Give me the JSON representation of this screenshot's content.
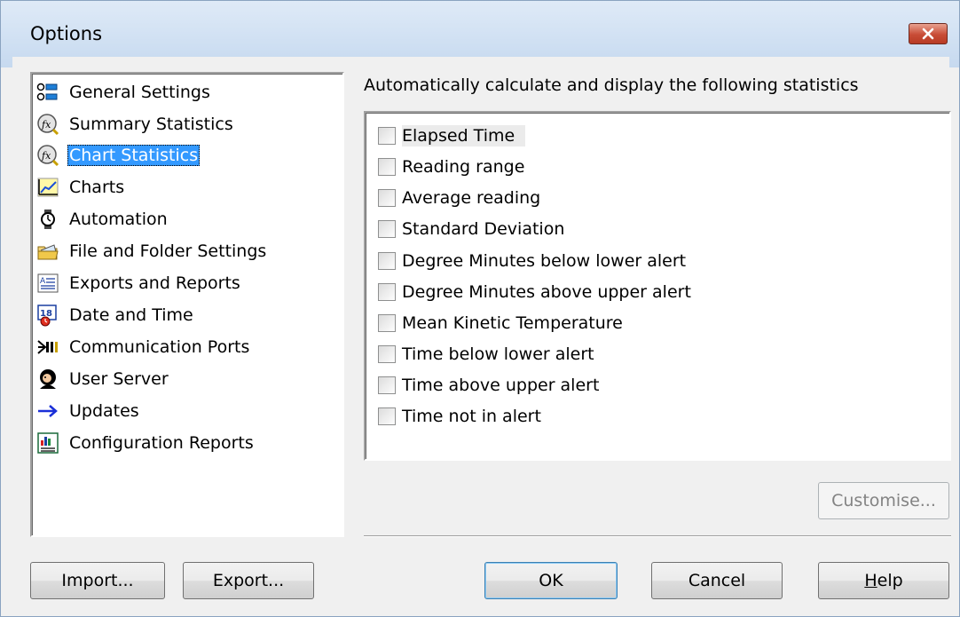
{
  "window": {
    "title": "Options",
    "close_icon": "close-icon"
  },
  "nav": {
    "items": [
      {
        "label": "General Settings",
        "icon": "general-settings-icon"
      },
      {
        "label": "Summary Statistics",
        "icon": "summary-statistics-icon"
      },
      {
        "label": "Chart Statistics",
        "icon": "chart-statistics-icon",
        "selected": true
      },
      {
        "label": "Charts",
        "icon": "charts-icon"
      },
      {
        "label": "Automation",
        "icon": "automation-icon"
      },
      {
        "label": "File and Folder Settings",
        "icon": "folder-icon"
      },
      {
        "label": "Exports and Reports",
        "icon": "exports-reports-icon"
      },
      {
        "label": "Date and Time",
        "icon": "date-time-icon"
      },
      {
        "label": "Communication Ports",
        "icon": "communication-ports-icon"
      },
      {
        "label": "User Server",
        "icon": "user-server-icon"
      },
      {
        "label": "Updates",
        "icon": "updates-arrow-icon"
      },
      {
        "label": "Configuration Reports",
        "icon": "configuration-reports-icon"
      }
    ]
  },
  "main": {
    "heading": "Automatically calculate and display the following statistics",
    "statistics": [
      {
        "label": "Elapsed Time",
        "checked": false
      },
      {
        "label": "Reading range",
        "checked": false
      },
      {
        "label": "Average reading",
        "checked": false
      },
      {
        "label": "Standard Deviation",
        "checked": false
      },
      {
        "label": "Degree Minutes below lower alert",
        "checked": false
      },
      {
        "label": "Degree Minutes above upper alert",
        "checked": false
      },
      {
        "label": "Mean Kinetic Temperature",
        "checked": false
      },
      {
        "label": "Time below lower alert",
        "checked": false
      },
      {
        "label": "Time above upper alert",
        "checked": false
      },
      {
        "label": "Time not in alert",
        "checked": false
      }
    ],
    "customise_label": "Customise..."
  },
  "footer": {
    "import_label": "Import...",
    "export_label": "Export...",
    "ok_label": "OK",
    "cancel_label": "Cancel",
    "help_label": "Help"
  },
  "colors": {
    "selection": "#3399ff",
    "close_button": "#c84c36"
  }
}
